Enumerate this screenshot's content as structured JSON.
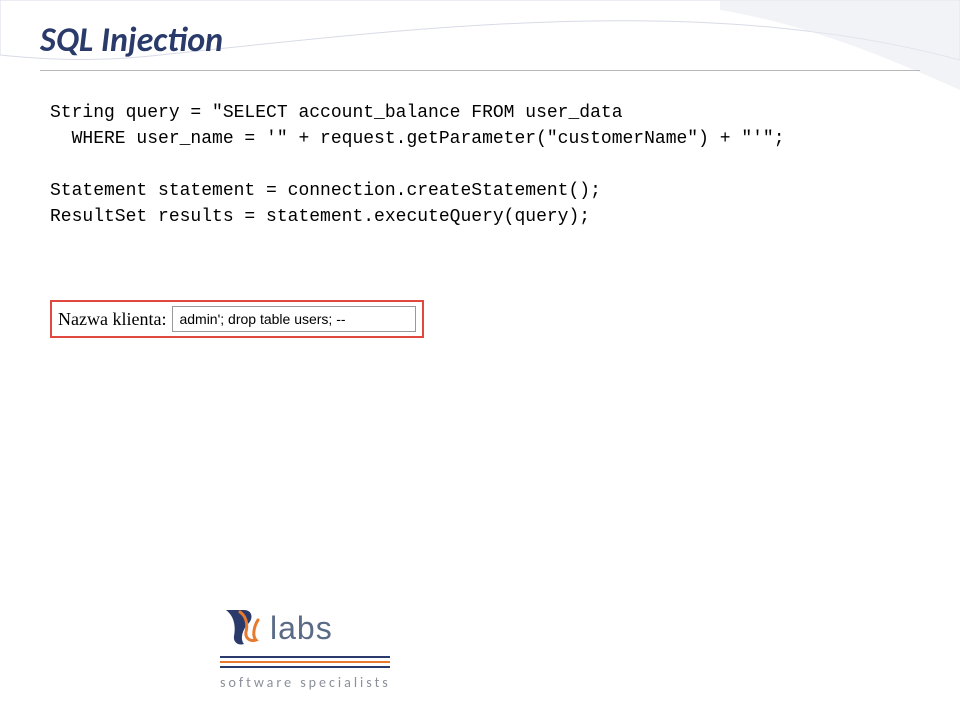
{
  "title": "SQL Injection",
  "code": {
    "line1": "String query = \"SELECT account_balance FROM user_data",
    "line2": "  WHERE user_name = '\" + request.getParameter(\"customerName\") + \"'\";",
    "line3": "",
    "line4": "Statement statement = connection.createStatement();",
    "line5": "ResultSet results = statement.executeQuery(query);"
  },
  "form": {
    "label": "Nazwa klienta:",
    "value": "admin'; drop table users; --"
  },
  "logo": {
    "text": "labs",
    "tagline": "software  specialists"
  }
}
